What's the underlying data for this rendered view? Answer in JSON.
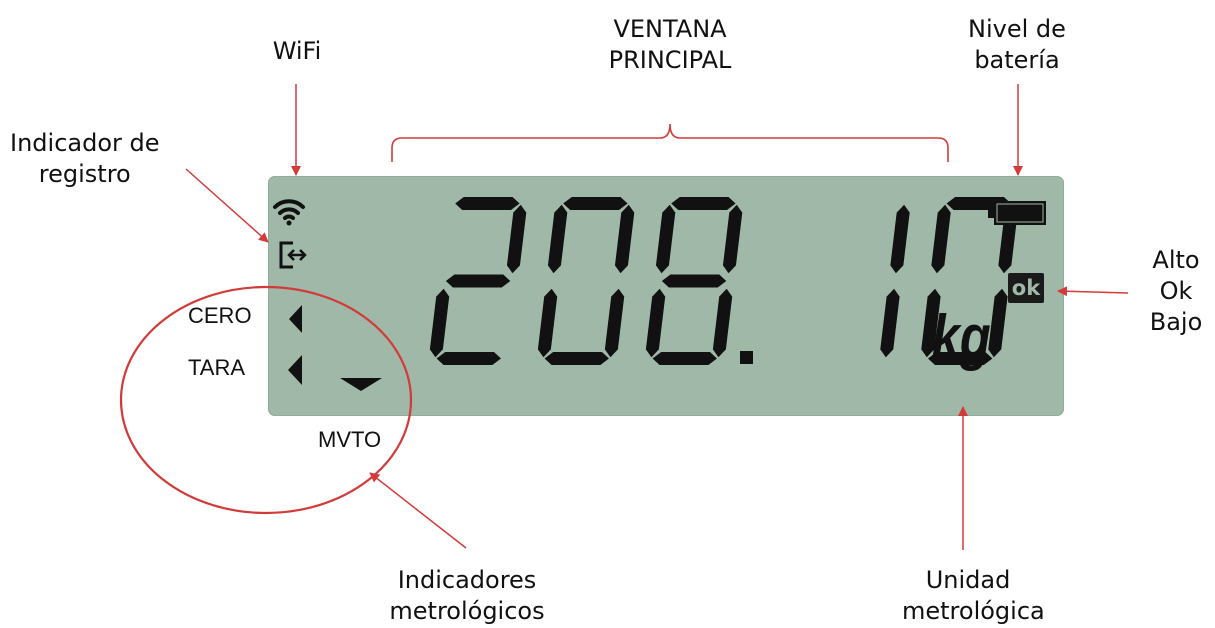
{
  "display": {
    "reading": "208.10",
    "unit": "kg",
    "status": "ok",
    "indicator_labels": {
      "zero": "CERO",
      "tare": "TARA",
      "motion": "MVTO"
    }
  },
  "callouts": {
    "wifi": "WiFi",
    "main_window": [
      "VENTANA",
      "PRINCIPAL"
    ],
    "battery": [
      "Nivel de",
      "batería"
    ],
    "record": [
      "Indicador de",
      "registro"
    ],
    "limits": [
      "Alto",
      "Ok",
      "Bajo"
    ],
    "metrological_indicators": [
      "Indicadores",
      "metrológicos"
    ],
    "metrological_unit": [
      "Unidad",
      "metrológica"
    ]
  },
  "colors": {
    "lcd_background": "#9fb8a8",
    "segment": "#111111",
    "annotation": "#d33a3a"
  }
}
